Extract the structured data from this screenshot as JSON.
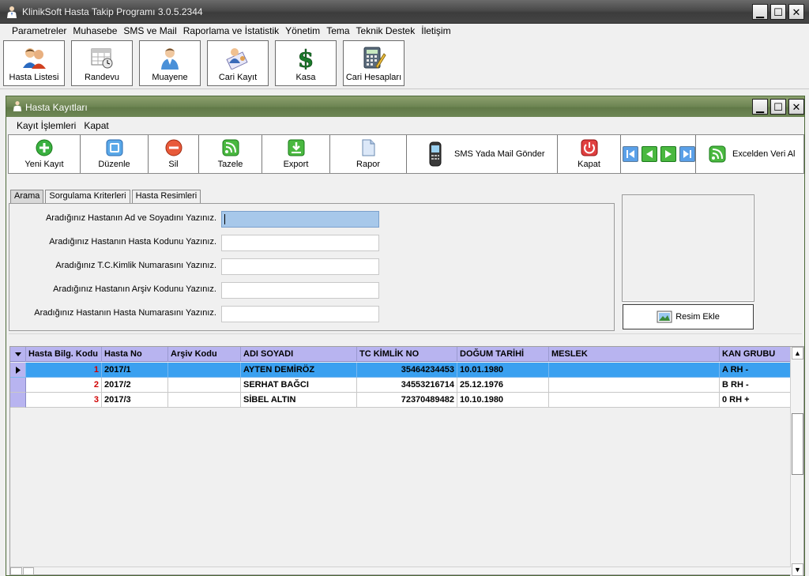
{
  "window": {
    "title": "KlinikSoft Hasta Takip Programı  3.0.5.2344"
  },
  "menu": [
    {
      "label": "Parametreler"
    },
    {
      "label": "Muhasebe"
    },
    {
      "label": "SMS ve Mail"
    },
    {
      "label": "Raporlama ve İstatistik"
    },
    {
      "label": "Yönetim"
    },
    {
      "label": "Tema"
    },
    {
      "label": "Teknik Destek"
    },
    {
      "label": "İletişim"
    }
  ],
  "big_toolbar": [
    {
      "label": "Hasta Listesi",
      "icon": "people-icon"
    },
    {
      "label": "Randevu",
      "icon": "calendar-clock-icon"
    },
    {
      "label": "Muayene",
      "icon": "doctor-icon"
    },
    {
      "label": "Cari Kayıt",
      "icon": "contact-card-icon"
    },
    {
      "label": "Kasa",
      "icon": "dollar-icon"
    },
    {
      "label": "Cari Hesapları",
      "icon": "calculator-icon"
    }
  ],
  "child": {
    "title": "Hasta Kayıtları",
    "menu": [
      {
        "label": "Kayıt İşlemleri"
      },
      {
        "label": "Kapat"
      }
    ],
    "toolbar": {
      "new": "Yeni Kayıt",
      "edit": "Düzenle",
      "delete": "Sil",
      "refresh": "Tazele",
      "export": "Export",
      "report": "Rapor",
      "sms": "SMS Yada Mail Gönder",
      "close": "Kapat",
      "excel": "Excelden Veri Al"
    },
    "tabs": [
      {
        "label": "Arama"
      },
      {
        "label": "Sorgulama Kriterleri"
      },
      {
        "label": "Hasta Resimleri"
      }
    ],
    "search": {
      "fields": [
        {
          "label": "Aradığınız Hastanın Ad ve Soyadını Yazınız.",
          "value": ""
        },
        {
          "label": "Aradığınız Hastanın Hasta Kodunu Yazınız.",
          "value": ""
        },
        {
          "label": "Aradığınız T.C.Kimlik Numarasını Yazınız.",
          "value": ""
        },
        {
          "label": "Aradığınız Hastanın Arşiv Kodunu Yazınız.",
          "value": ""
        },
        {
          "label": "Aradığınız Hastanın Hasta Numarasını Yazınız.",
          "value": ""
        }
      ]
    },
    "photo": {
      "add_label": "Resim Ekle"
    },
    "grid": {
      "columns": [
        "Hasta Bilg. Kodu",
        "Hasta No",
        "Arşiv Kodu",
        "ADI SOYADI",
        "TC KİMLİK NO",
        "DOĞUM TARİHİ",
        "MESLEK",
        "KAN GRUBU"
      ],
      "rows": [
        {
          "code": "1",
          "no": "2017/1",
          "archive": "",
          "name": "AYTEN DEMİRÖZ",
          "tc": "35464234453",
          "birth": "10.01.1980",
          "job": "",
          "blood": "A RH -"
        },
        {
          "code": "2",
          "no": "2017/2",
          "archive": "",
          "name": "SERHAT BAĞCI",
          "tc": "34553216714",
          "birth": "25.12.1976",
          "job": "",
          "blood": "B RH -"
        },
        {
          "code": "3",
          "no": "2017/3",
          "archive": "",
          "name": "SİBEL ALTIN",
          "tc": "72370489482",
          "birth": "10.10.1980",
          "job": "",
          "blood": "0 RH +"
        }
      ]
    }
  }
}
